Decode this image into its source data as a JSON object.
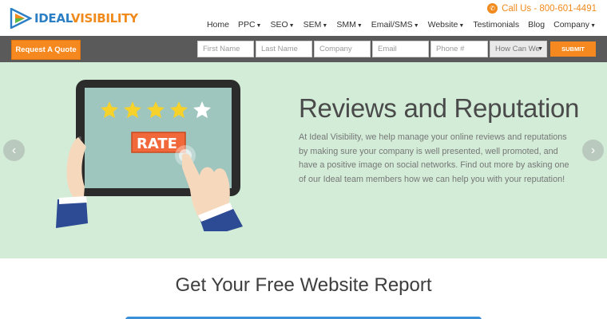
{
  "brand": {
    "part1": "IDEAL",
    "part2": "VISIBILITY"
  },
  "header": {
    "call_label": "Call Us - 800-601-4491",
    "nav": [
      {
        "label": "Home",
        "dropdown": false
      },
      {
        "label": "PPC",
        "dropdown": true
      },
      {
        "label": "SEO",
        "dropdown": true
      },
      {
        "label": "SEM",
        "dropdown": true
      },
      {
        "label": "SMM",
        "dropdown": true
      },
      {
        "label": "Email/SMS",
        "dropdown": true
      },
      {
        "label": "Website",
        "dropdown": true
      },
      {
        "label": "Testimonials",
        "dropdown": false
      },
      {
        "label": "Blog",
        "dropdown": false
      },
      {
        "label": "Company",
        "dropdown": true
      }
    ]
  },
  "form": {
    "quote_label": "Request A Quote",
    "first_name": "First Name",
    "last_name": "Last Name",
    "company": "Company",
    "email": "Email",
    "phone": "Phone #",
    "help_select": "How Can We",
    "submit_label": "SUBMIT"
  },
  "hero": {
    "title": "Reviews and Reputation",
    "text": "At Ideal Visibility, we help manage your online reviews and reputations by making sure your company is well presented, well promoted, and have a positive image on social networks. Find out more by asking one of our Ideal team members how we can help you with your reputation!",
    "rate_label": "RATE",
    "stars_filled": 4,
    "stars_total": 5
  },
  "report": {
    "title": "Get Your Free Website Report"
  },
  "colors": {
    "accent": "#f5891f",
    "brand_blue": "#2c7fc4",
    "hero_bg": "#d2ecd7"
  }
}
